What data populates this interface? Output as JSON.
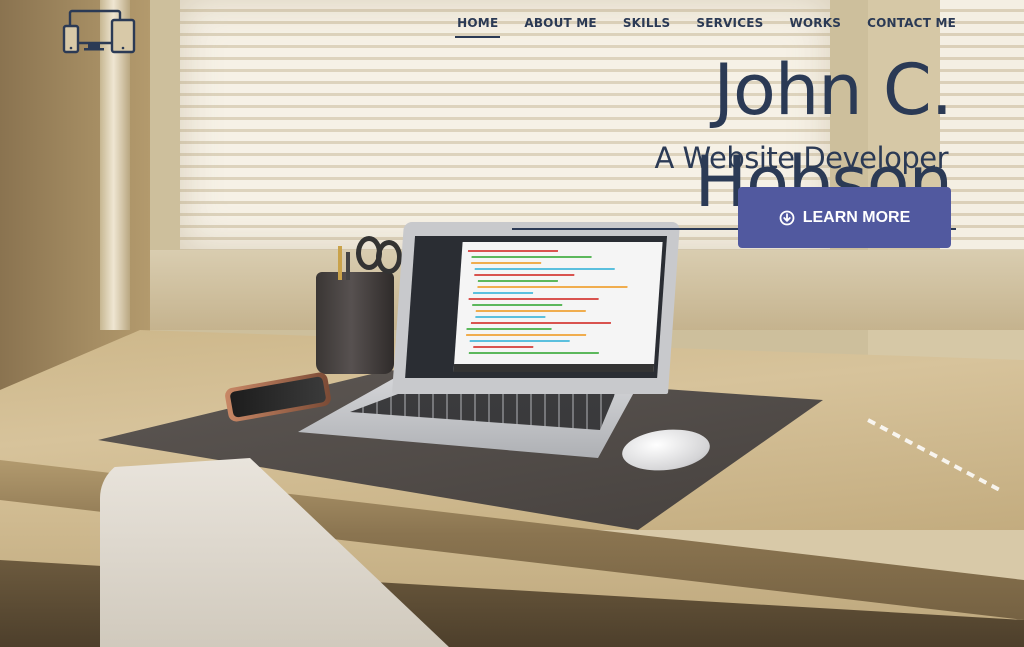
{
  "nav": {
    "items": [
      {
        "label": "HOME",
        "active": true
      },
      {
        "label": "ABOUT ME",
        "active": false
      },
      {
        "label": "SKILLS",
        "active": false
      },
      {
        "label": "SERVICES",
        "active": false
      },
      {
        "label": "WORKS",
        "active": false
      },
      {
        "label": "CONTACT ME",
        "active": false
      }
    ]
  },
  "logo": {
    "icon": "devices-icon"
  },
  "hero": {
    "name": "John C. Hobson",
    "subtitle": "A Website Developer",
    "cta_label": "LEARN MORE",
    "cta_icon": "circle-arrow-down-icon"
  },
  "colors": {
    "text": "#2b3a55",
    "button_bg": "#51599f",
    "button_text": "#ffffff"
  }
}
